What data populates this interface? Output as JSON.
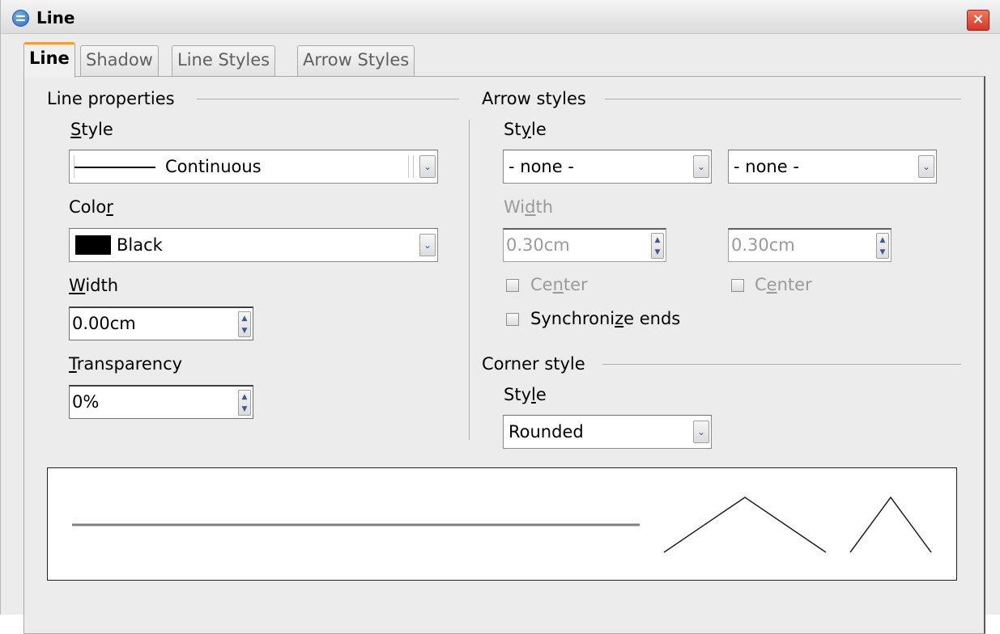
{
  "window": {
    "title": "Line",
    "close_glyph": "×"
  },
  "tabs": [
    {
      "label": "Line",
      "active": true
    },
    {
      "label": "Shadow",
      "active": false
    },
    {
      "label": "Line Styles",
      "active": false
    },
    {
      "label": "Arrow Styles",
      "active": false
    }
  ],
  "line_properties": {
    "title": "Line properties",
    "style": {
      "label_prefix": "",
      "label_u": "S",
      "label_rest": "tyle",
      "value": "Continuous"
    },
    "color": {
      "label_prefix": "Colo",
      "label_u": "r",
      "label_rest": "",
      "value": "Black",
      "swatch": "#000000"
    },
    "width": {
      "label_prefix": "",
      "label_u": "W",
      "label_rest": "idth",
      "value": "0.00cm"
    },
    "transparency": {
      "label_prefix": "",
      "label_u": "T",
      "label_rest": "ransparency",
      "value": "0%"
    }
  },
  "arrow_styles": {
    "title": "Arrow styles",
    "style": {
      "label_prefix": "St",
      "label_u": "y",
      "label_rest": "le",
      "start_value": "- none -",
      "end_value": "- none -"
    },
    "width": {
      "label_prefix": "Wi",
      "label_u": "d",
      "label_rest": "th",
      "start_value": "0.30cm",
      "end_value": "0.30cm"
    },
    "center_start": {
      "label_prefix": "Ce",
      "label_u": "n",
      "label_rest": "ter",
      "checked": false
    },
    "center_end": {
      "label_prefix": "C",
      "label_u": "e",
      "label_rest": "nter",
      "checked": false
    },
    "synchronize": {
      "label_prefix": "Synchroni",
      "label_u": "z",
      "label_rest": "e ends",
      "checked": false
    }
  },
  "corner_style": {
    "title": "Corner style",
    "style": {
      "label_prefix": "Sty",
      "label_u": "l",
      "label_rest": "e",
      "value": "Rounded"
    }
  },
  "colors": {
    "active_tab_accent": "#f0a030",
    "close_button": "#d8342a",
    "disabled_text": "#9a9a9a"
  },
  "icons": {
    "app": "libreoffice-icon",
    "dropdown": "chevron-down-icon",
    "spin_up": "chevron-up-icon",
    "spin_down": "chevron-down-icon"
  },
  "glyphs": {
    "chevron_down": "⌄",
    "spin_up": "▲",
    "spin_down": "▼"
  }
}
